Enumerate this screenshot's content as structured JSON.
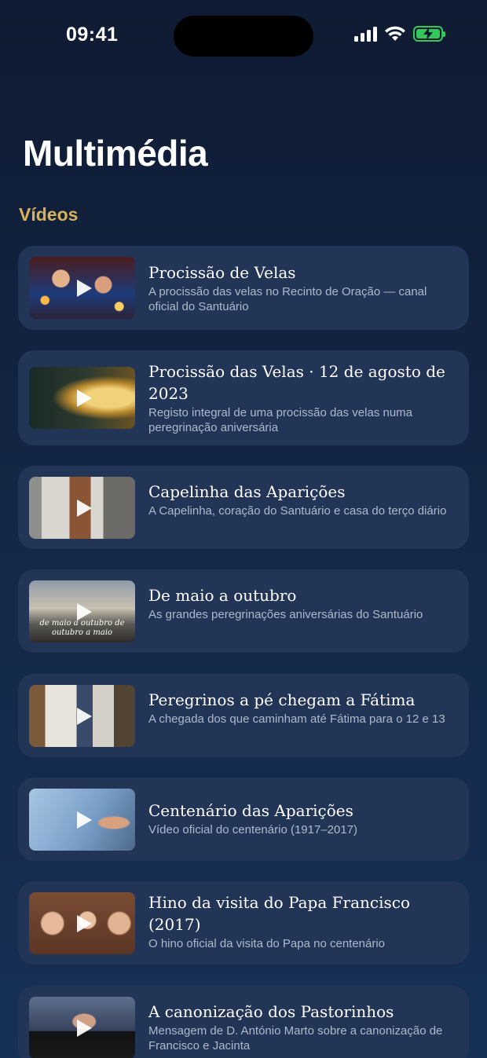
{
  "status_bar": {
    "time": "09:41",
    "icons": [
      "signal-icon",
      "wifi-icon",
      "battery-charging-icon"
    ],
    "battery_color": "#34c759"
  },
  "page": {
    "title": "Multimédia",
    "section_title": "Vídeos",
    "accent_color": "#d9b15a"
  },
  "videos": [
    {
      "title": "Procissão de Velas",
      "description": "A procissão das velas no Recinto de Oração — canal oficial do Santuário"
    },
    {
      "title": "Procissão das Velas · 12 de agosto de 2023",
      "description": "Registo integral de uma procissão das velas numa peregrinação aniversária"
    },
    {
      "title": "Capelinha das Aparições",
      "description": "A Capelinha, coração do Santuário e casa do terço diário"
    },
    {
      "title": "De maio a outubro",
      "description": "As grandes peregrinações aniversárias do Santuário",
      "thumb_caption": "de maio a outubro de outubro a maio"
    },
    {
      "title": "Peregrinos a pé chegam a Fátima",
      "description": "A chegada dos que caminham até Fátima para o 12 e 13"
    },
    {
      "title": "Centenário das Aparições",
      "description": "Vídeo oficial do centenário (1917–2017)"
    },
    {
      "title": "Hino da visita do Papa Francisco (2017)",
      "description": "O hino oficial da visita do Papa no centenário"
    },
    {
      "title": "A canonização dos Pastorinhos",
      "description": "Mensagem de D. António Marto sobre a canonização de Francisco e Jacinta"
    }
  ]
}
